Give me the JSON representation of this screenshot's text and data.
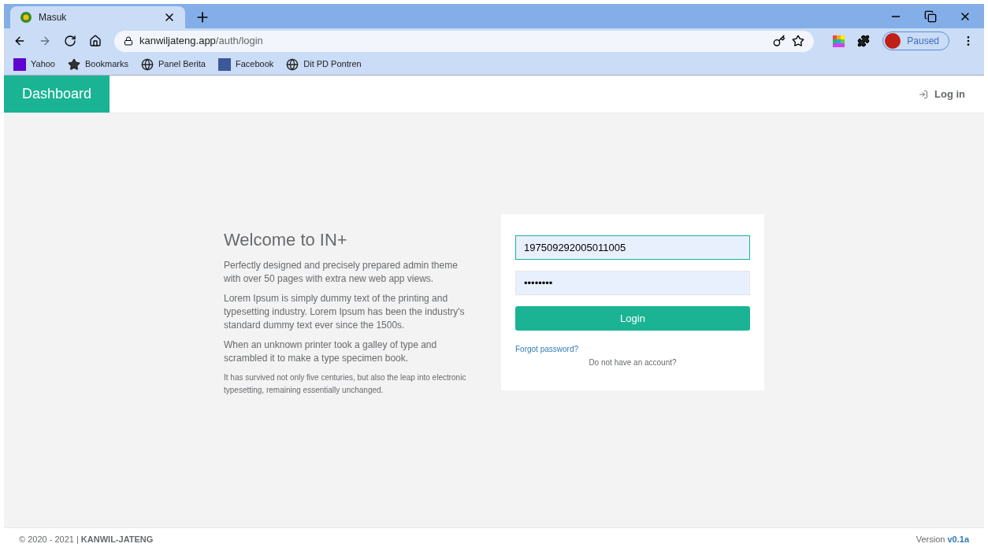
{
  "browser": {
    "tab": {
      "title": "Masuk",
      "selected": true
    },
    "url": {
      "host": "kanwiljateng.app",
      "path": "/auth/login"
    },
    "profile": "Paused",
    "bookmarks": [
      {
        "kind": "yahoo",
        "label": "Yahoo"
      },
      {
        "kind": "star",
        "label": "Bookmarks"
      },
      {
        "kind": "globe",
        "label": "Panel Berita"
      },
      {
        "kind": "facebook",
        "label": "Facebook"
      },
      {
        "kind": "globe",
        "label": "Dit PD Pontren"
      }
    ]
  },
  "navbar": {
    "brand": "Dashboard",
    "login": "Log in"
  },
  "welcome": {
    "title": "Welcome to IN+",
    "paragraphs": [
      "Perfectly designed and precisely prepared admin theme with over 50 pages with extra new web app views.",
      "Lorem Ipsum is simply dummy text of the printing and typesetting industry. Lorem Ipsum has been the industry's standard dummy text ever since the 1500s.",
      "When an unknown printer took a galley of type and scrambled it to make a type specimen book."
    ],
    "note": "It has survived not only five centuries, but also the leap into electronic typesetting, remaining essentially unchanged."
  },
  "form": {
    "username": "197509292005011005",
    "password": "••••••••",
    "button": "Login",
    "forgot": "Forgot password?",
    "register": "Do not have an account?"
  },
  "footer": {
    "copyright": "© 2020 - 2021 | **KANWIL-JATENG**",
    "version": "Version **v0.1a**"
  }
}
